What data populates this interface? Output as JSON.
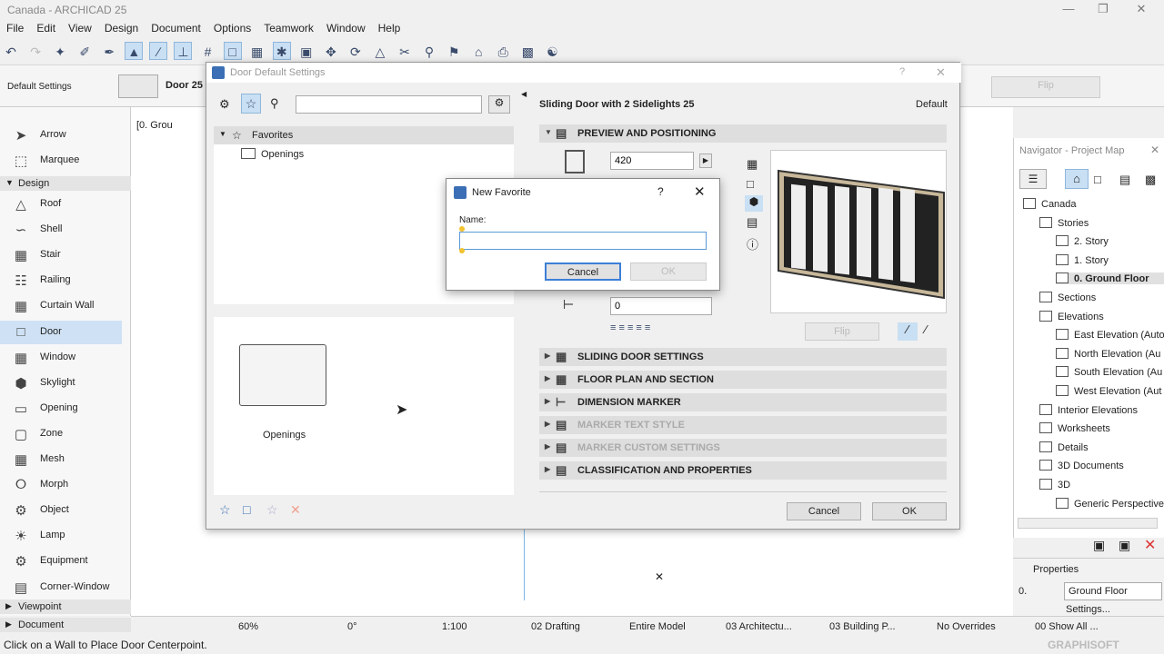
{
  "app": {
    "title": "Canada - ARCHICAD 25",
    "brand": "GRAPHISOFT"
  },
  "menu": [
    "File",
    "Edit",
    "View",
    "Design",
    "Document",
    "Options",
    "Teamwork",
    "Window",
    "Help"
  ],
  "infobox": {
    "label": "Default Settings",
    "door_name": "Door 25",
    "flip": "Flip"
  },
  "toolbox": {
    "tools_top": [
      {
        "label": "Arrow",
        "icon": "arrow-icon"
      },
      {
        "label": "Marquee",
        "icon": "marquee-icon"
      }
    ],
    "design_section": "Design",
    "design_tools": [
      {
        "label": "Roof"
      },
      {
        "label": "Shell"
      },
      {
        "label": "Stair"
      },
      {
        "label": "Railing"
      },
      {
        "label": "Curtain Wall"
      },
      {
        "label": "Door"
      },
      {
        "label": "Window"
      },
      {
        "label": "Skylight"
      },
      {
        "label": "Opening"
      },
      {
        "label": "Zone"
      },
      {
        "label": "Mesh"
      },
      {
        "label": "Morph"
      },
      {
        "label": "Object"
      },
      {
        "label": "Lamp"
      },
      {
        "label": "Equipment"
      },
      {
        "label": "Corner-Window"
      }
    ],
    "viewpoint": "Viewpoint",
    "document": "Document"
  },
  "canvas": {
    "tab_label": "[0. Grou"
  },
  "dialog": {
    "title": "Door Default Settings",
    "favorites_label": "Favorites",
    "openings_folder": "Openings",
    "folder_caption": "Openings",
    "object_name": "Sliding Door with 2 Sidelights 25",
    "default_label": "Default",
    "sections": [
      {
        "label": "PREVIEW AND POSITIONING",
        "open": true,
        "disabled": false
      },
      {
        "label": "SLIDING DOOR SETTINGS",
        "open": false,
        "disabled": false
      },
      {
        "label": "FLOOR PLAN AND SECTION",
        "open": false,
        "disabled": false
      },
      {
        "label": "DIMENSION MARKER",
        "open": false,
        "disabled": false
      },
      {
        "label": "MARKER TEXT STYLE",
        "open": false,
        "disabled": true
      },
      {
        "label": "MARKER CUSTOM SETTINGS",
        "open": false,
        "disabled": true
      },
      {
        "label": "CLASSIFICATION AND PROPERTIES",
        "open": false,
        "disabled": false
      }
    ],
    "width_value": "420",
    "offset_value": "0",
    "flip_label": "Flip",
    "cancel": "Cancel",
    "ok": "OK"
  },
  "new_favorite": {
    "title": "New Favorite",
    "help": "?",
    "name_label": "Name:",
    "name_value": "",
    "cancel": "Cancel",
    "ok": "OK"
  },
  "navigator": {
    "title": "Navigator - Project Map",
    "items": [
      {
        "label": "Canada",
        "level": 0
      },
      {
        "label": "Stories",
        "level": 1
      },
      {
        "label": "2. Story",
        "level": 2
      },
      {
        "label": "1. Story",
        "level": 2
      },
      {
        "label": "0. Ground Floor",
        "level": 2,
        "bold": true
      },
      {
        "label": "Sections",
        "level": 1
      },
      {
        "label": "Elevations",
        "level": 1
      },
      {
        "label": "East Elevation (Auto",
        "level": 2
      },
      {
        "label": "North Elevation (Au",
        "level": 2
      },
      {
        "label": "South Elevation (Au",
        "level": 2
      },
      {
        "label": "West Elevation (Aut",
        "level": 2
      },
      {
        "label": "Interior Elevations",
        "level": 1
      },
      {
        "label": "Worksheets",
        "level": 1
      },
      {
        "label": "Details",
        "level": 1
      },
      {
        "label": "3D Documents",
        "level": 1
      },
      {
        "label": "3D",
        "level": 1
      },
      {
        "label": "Generic Perspective",
        "level": 2
      }
    ]
  },
  "properties": {
    "title": "Properties",
    "story_num": "0.",
    "story_name": "Ground Floor",
    "settings": "Settings..."
  },
  "bottom": {
    "zoom": "60%",
    "angle": "0°",
    "scale": "1:100",
    "layer": "02 Drafting",
    "model": "Entire Model",
    "pen": "03 Architectu...",
    "mvo": "03 Building P...",
    "overrides": "No Overrides",
    "renovation": "00 Show All ..."
  },
  "status_text": "Click on a Wall to Place Door Centerpoint."
}
